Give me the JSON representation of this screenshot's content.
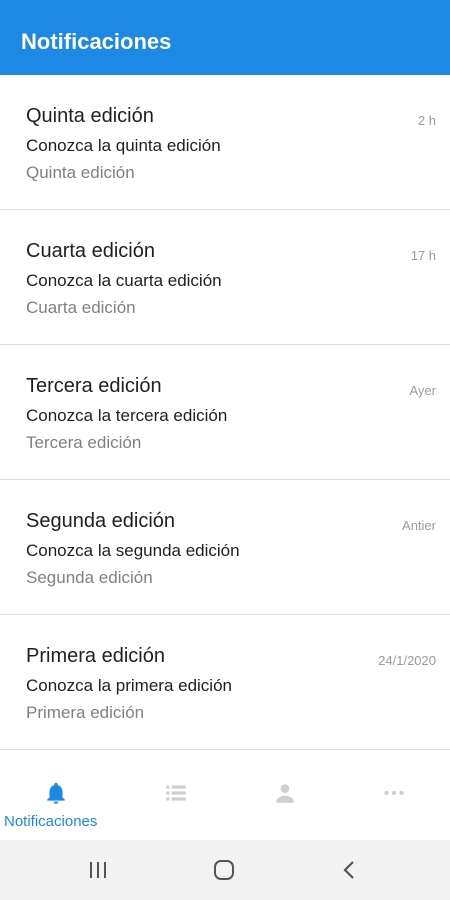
{
  "app_bar": {
    "title": "Notificaciones"
  },
  "notifications": [
    {
      "title": "Quinta edición",
      "subtitle": "Conozca la quinta edición",
      "caption": "Quinta edición",
      "time": "2 h"
    },
    {
      "title": "Cuarta edición",
      "subtitle": "Conozca la cuarta edición",
      "caption": "Cuarta edición",
      "time": "17 h"
    },
    {
      "title": "Tercera edición",
      "subtitle": "Conozca la tercera edición",
      "caption": "Tercera edición",
      "time": "Ayer"
    },
    {
      "title": "Segunda edición",
      "subtitle": "Conozca la segunda edición",
      "caption": "Segunda edición",
      "time": "Antier"
    },
    {
      "title": "Primera edición",
      "subtitle": "Conozca la primera edición",
      "caption": "Primera edición",
      "time": "24/1/2020"
    }
  ],
  "bottom_nav": {
    "active_label": "Notificaciones",
    "tabs": [
      {
        "icon": "bell-icon",
        "active": true
      },
      {
        "icon": "list-icon",
        "active": false
      },
      {
        "icon": "person-icon",
        "active": false
      },
      {
        "icon": "more-icon",
        "active": false
      }
    ]
  },
  "system_nav": {
    "buttons": [
      "recent-apps-icon",
      "home-icon",
      "back-icon"
    ]
  },
  "colors": {
    "accent": "#1e88e5",
    "inactive_icon": "#cfcfcf",
    "text_primary": "#1f1f1f",
    "text_secondary": "#808080"
  }
}
